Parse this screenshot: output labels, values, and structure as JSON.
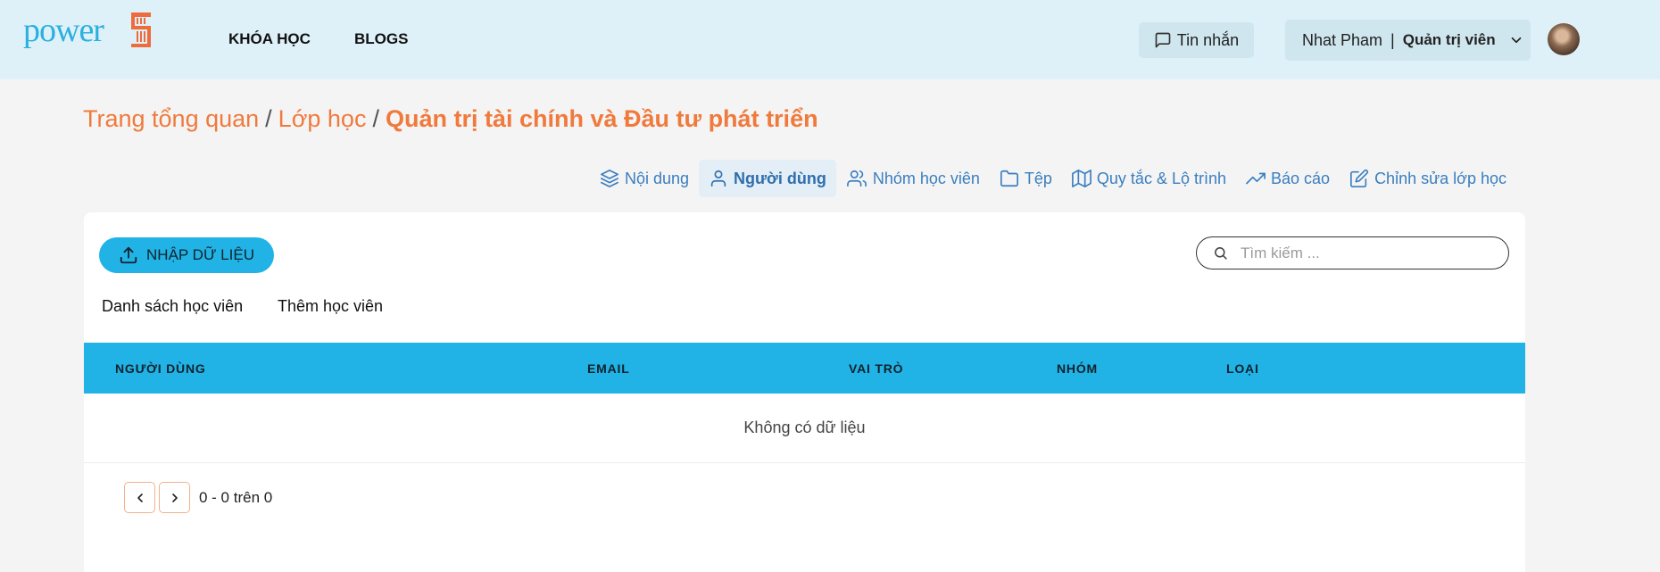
{
  "header": {
    "logo_text": "power5",
    "nav": [
      "KHÓA HỌC",
      "BLOGS"
    ],
    "messages_label": "Tin nhắn",
    "user_name": "Nhat Pham",
    "user_separator": "|",
    "user_role": "Quản trị viên"
  },
  "breadcrumb": {
    "items": [
      "Trang tổng quan",
      "Lớp học"
    ],
    "separator": "/",
    "current": "Quản trị tài chính và Đầu tư phát triển"
  },
  "tabs": [
    {
      "label": "Nội dung",
      "icon": "layers-icon",
      "active": false
    },
    {
      "label": "Người dùng",
      "icon": "user-icon",
      "active": true
    },
    {
      "label": "Nhóm học viên",
      "icon": "users-icon",
      "active": false
    },
    {
      "label": "Tệp",
      "icon": "folder-icon",
      "active": false
    },
    {
      "label": "Quy tắc & Lộ trình",
      "icon": "map-icon",
      "active": false
    },
    {
      "label": "Báo cáo",
      "icon": "trending-up-icon",
      "active": false
    },
    {
      "label": "Chỉnh sửa lớp học",
      "icon": "edit-icon",
      "active": false
    }
  ],
  "toolbar": {
    "import_label": "NHẬP DỮ LIỆU",
    "search_placeholder": "Tìm kiếm ..."
  },
  "subtabs": [
    "Danh sách học viên",
    "Thêm học viên"
  ],
  "table": {
    "columns": [
      "NGƯỜI DÙNG",
      "EMAIL",
      "VAI TRÒ",
      "NHÓM",
      "LOẠI"
    ],
    "empty_text": "Không có dữ liệu"
  },
  "pagination": {
    "text": "0 - 0 trên 0"
  },
  "colors": {
    "accent_blue": "#22b3e6",
    "breadcrumb_orange": "#f07a3c",
    "tab_blue": "#3a7ec0",
    "header_bg": "#dff1f8"
  }
}
